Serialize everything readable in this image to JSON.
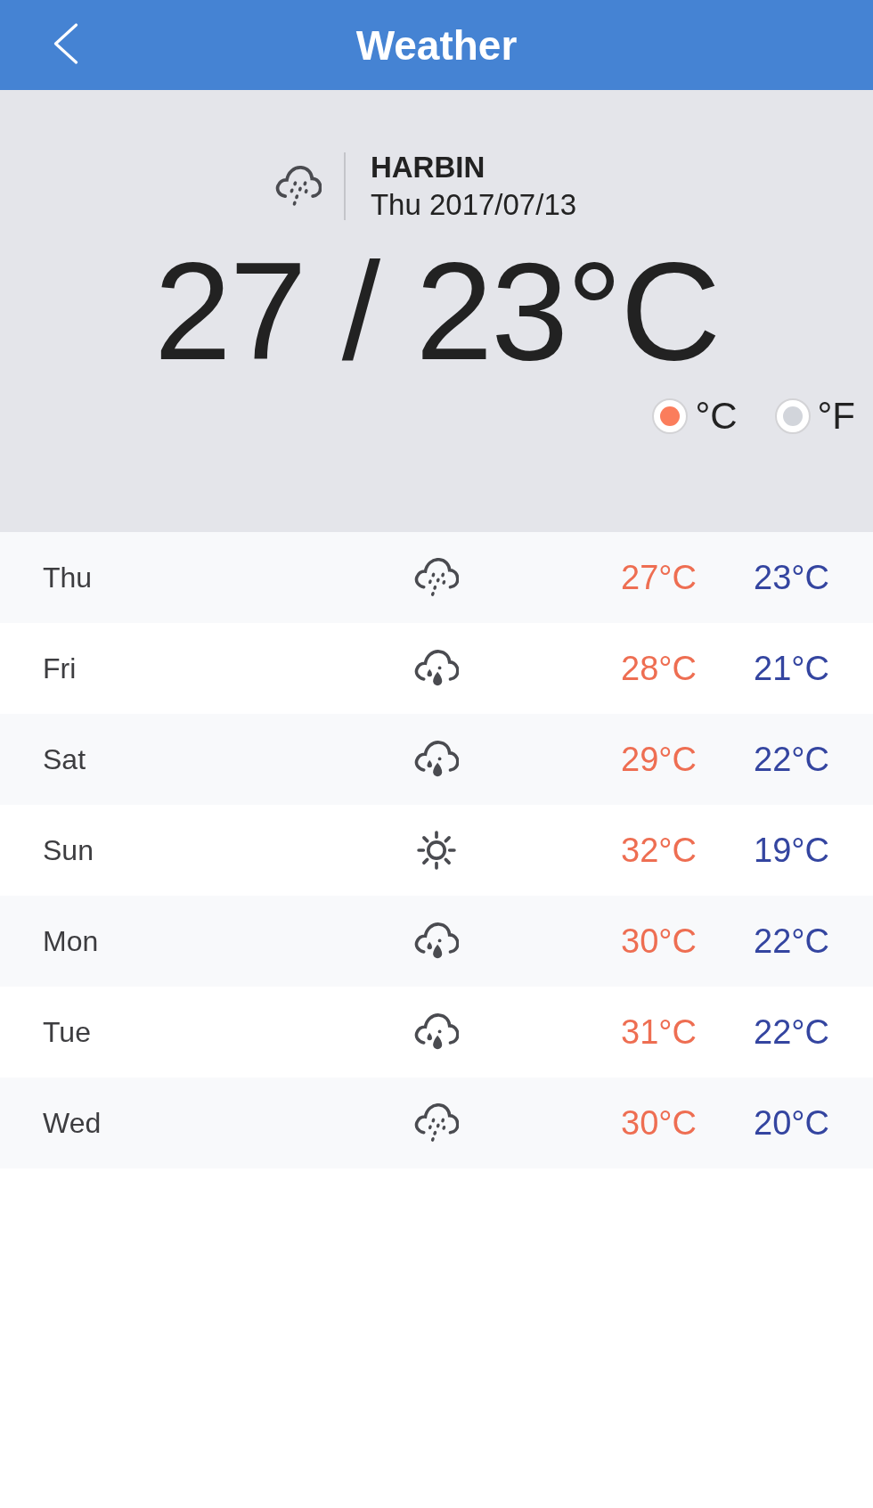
{
  "header": {
    "title": "Weather"
  },
  "location": {
    "kind": "drizzle",
    "city": "HARBIN",
    "date": "Thu 2017/07/13"
  },
  "temperature": {
    "reading": "27 / 23°C"
  },
  "units": [
    {
      "label": "°C",
      "selected": true
    },
    {
      "label": "°F",
      "selected": false
    }
  ],
  "forecast": [
    {
      "day": "Thu",
      "kind": "drizzle",
      "high": "27°C",
      "low": "23°C"
    },
    {
      "day": "Fri",
      "kind": "showers",
      "high": "28°C",
      "low": "21°C"
    },
    {
      "day": "Sat",
      "kind": "showers",
      "high": "29°C",
      "low": "22°C"
    },
    {
      "day": "Sun",
      "kind": "sunny",
      "high": "32°C",
      "low": "19°C"
    },
    {
      "day": "Mon",
      "kind": "showers",
      "high": "30°C",
      "low": "22°C"
    },
    {
      "day": "Tue",
      "kind": "showers",
      "high": "31°C",
      "low": "22°C"
    },
    {
      "day": "Wed",
      "kind": "drizzle",
      "high": "30°C",
      "low": "20°C"
    }
  ]
}
